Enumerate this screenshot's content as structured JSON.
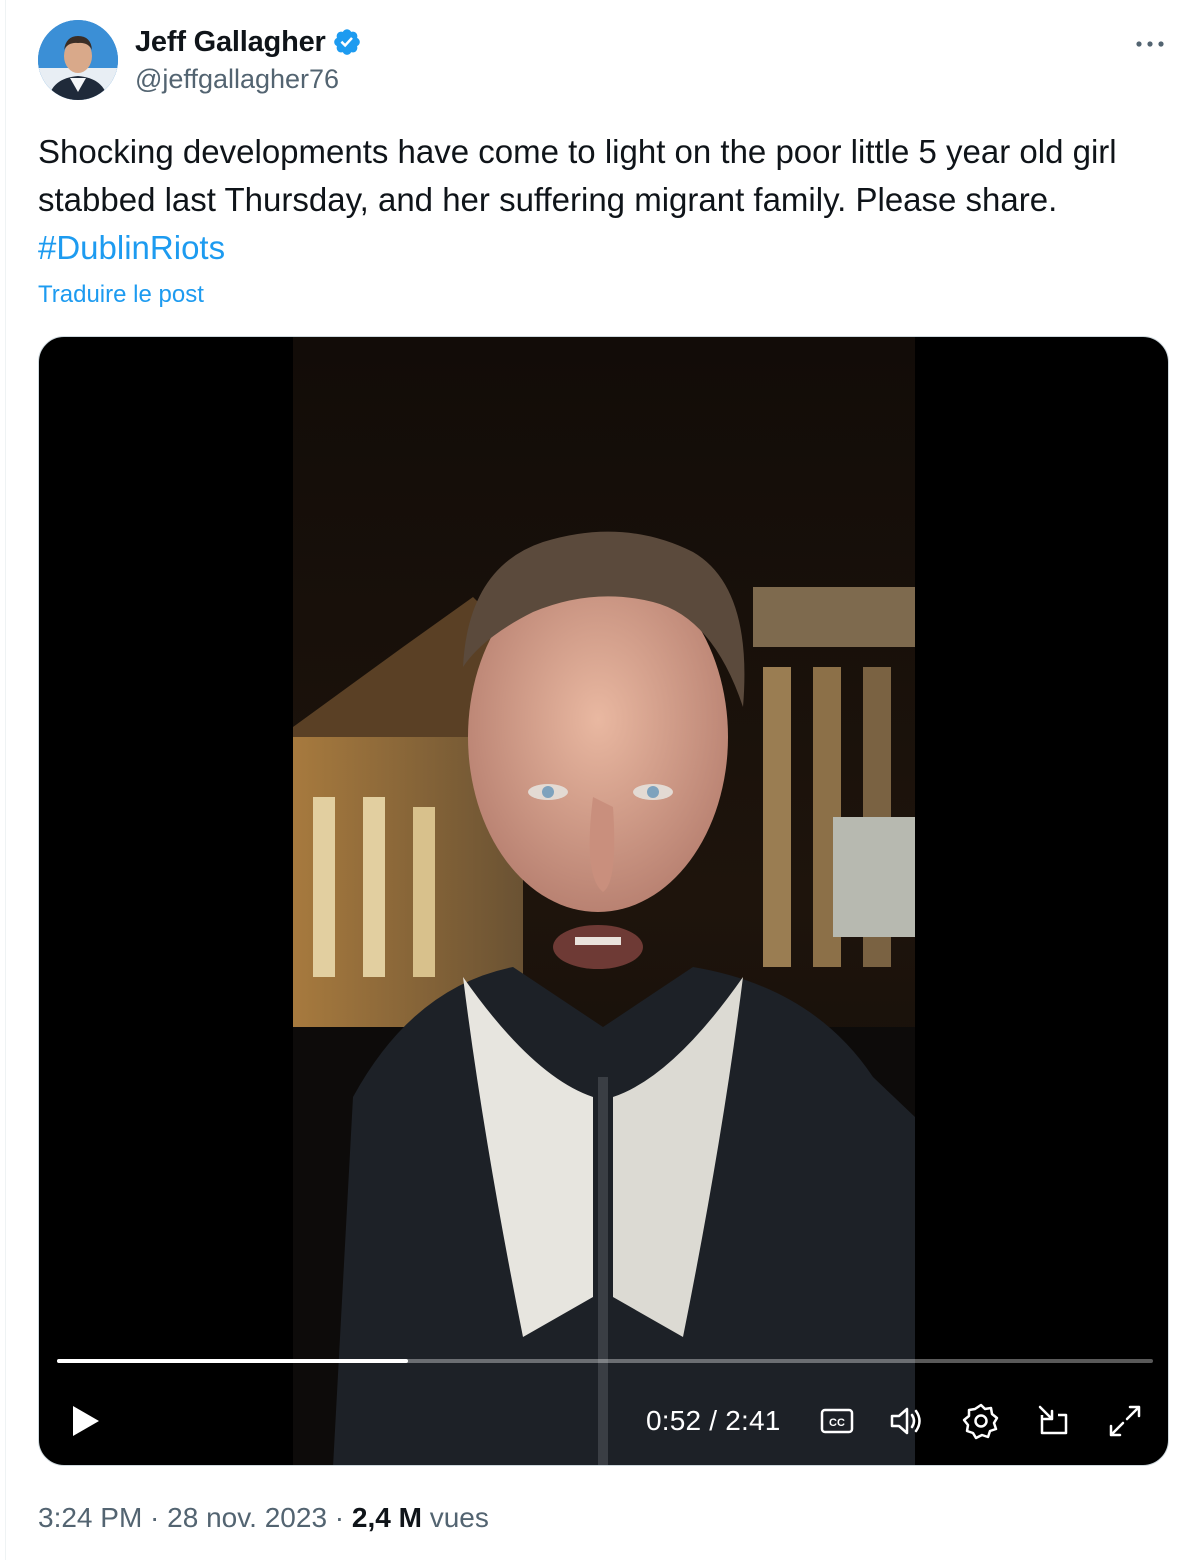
{
  "author": {
    "display_name": "Jeff Gallagher",
    "handle": "@jeffgallagher76",
    "verified": true,
    "avatar": "profile-photo"
  },
  "tweet": {
    "text_before": "Shocking developments have come to light on the poor little 5 year old girl stabbed last Thursday, and her suffering migrant family. Please share. ",
    "hashtag": "#DublinRiots",
    "translate_label": "Traduire le post"
  },
  "video": {
    "current_time": "0:52",
    "separator": " / ",
    "duration": "2:41",
    "progress": 0.32,
    "controls": {
      "play": "play-icon",
      "captions": "captions-icon",
      "volume": "volume-icon",
      "settings": "settings-icon",
      "pip": "picture-in-picture-icon",
      "fullscreen": "fullscreen-icon"
    }
  },
  "meta": {
    "time": "3:24 PM",
    "dot": " · ",
    "date": "28 nov. 2023",
    "dot2": " · ",
    "views_count": "2,4 M",
    "views_label": " vues"
  },
  "colors": {
    "accent": "#1d9bf0",
    "secondary_text": "#536471",
    "primary_text": "#0f1419"
  }
}
